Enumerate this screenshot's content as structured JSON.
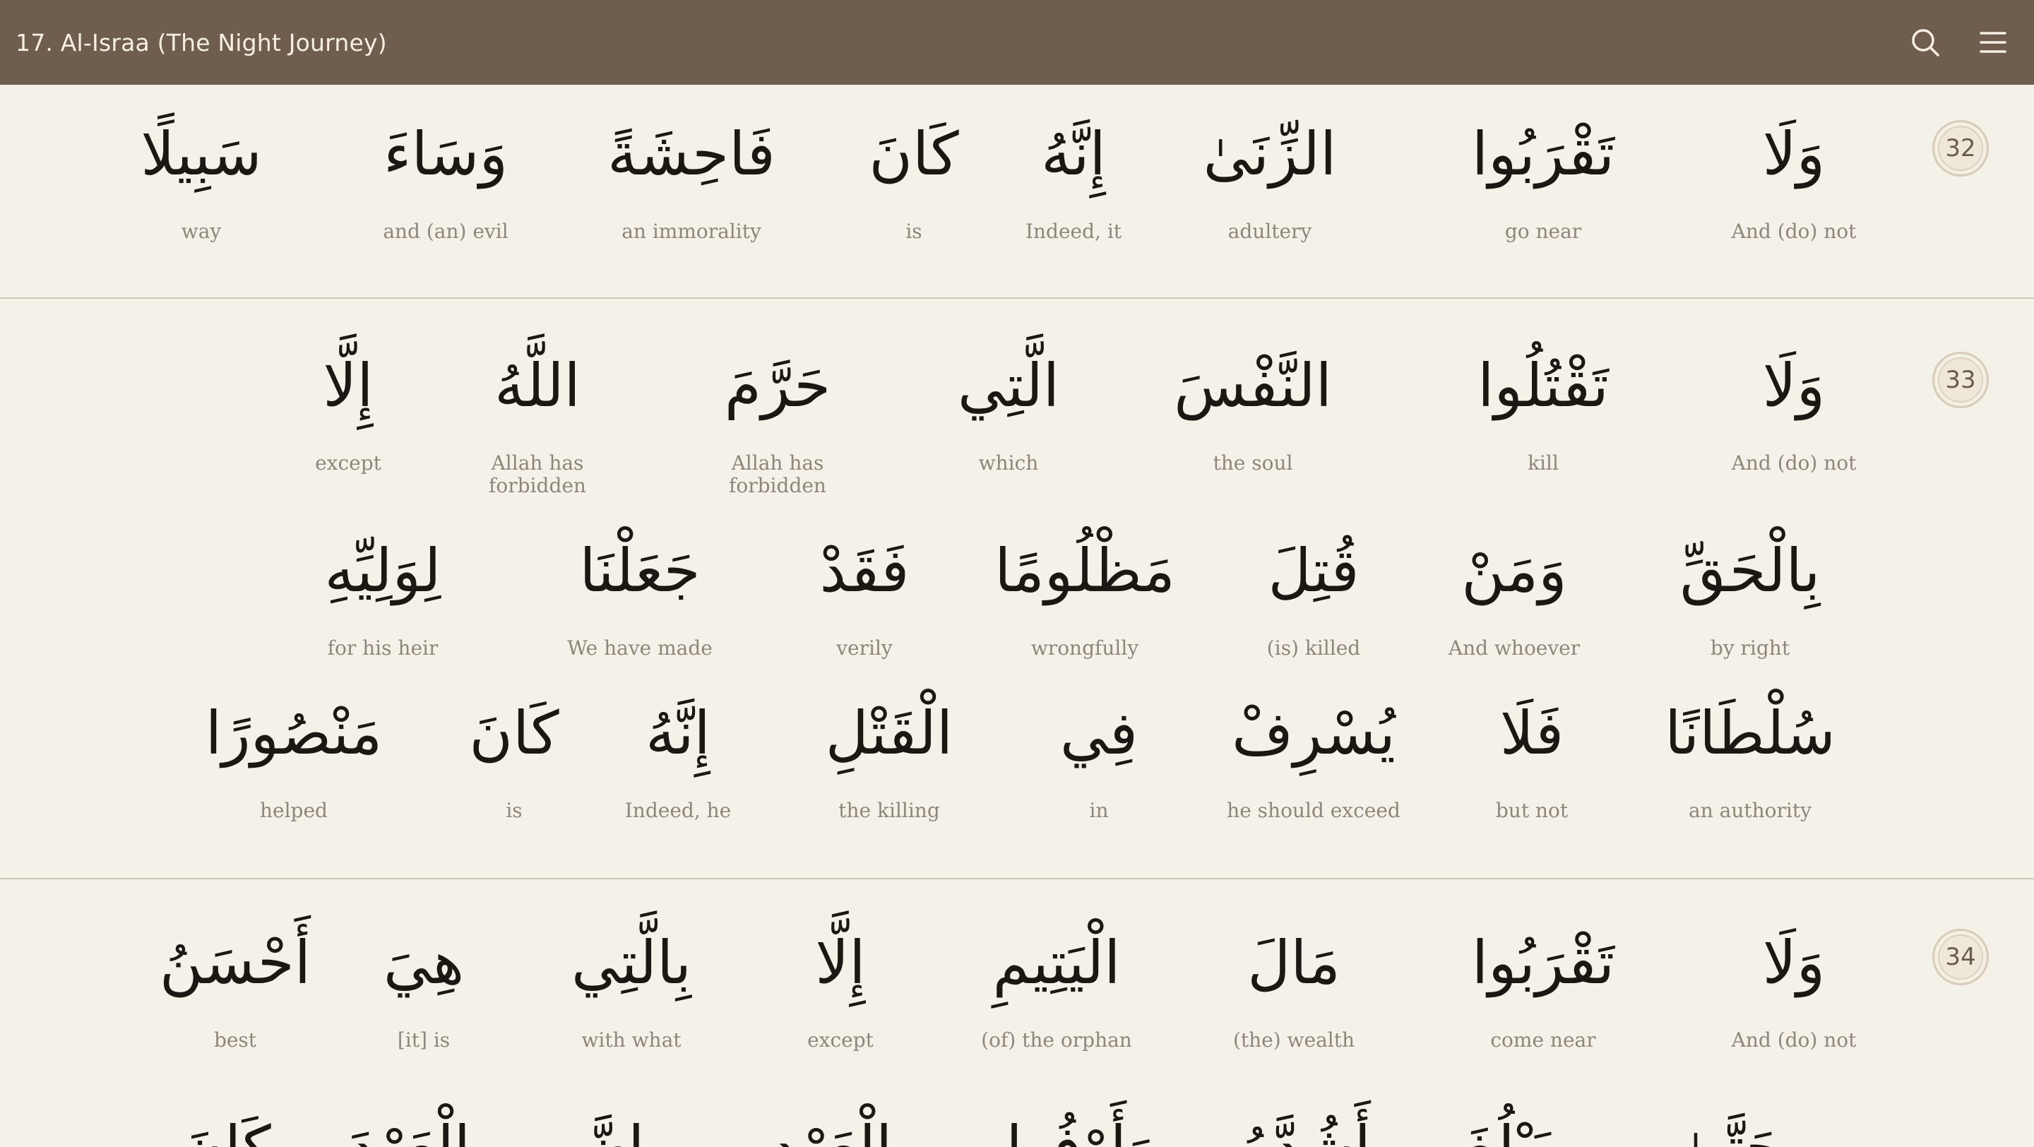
{
  "header": {
    "title": "17. Al-Israa (The Night Journey)",
    "search_icon": "search-icon",
    "menu_icon": "menu-icon"
  },
  "verses": [
    {
      "number": "32",
      "lines": [
        [
          {
            "ar": "وَلَا",
            "en": "And (do) not"
          },
          {
            "ar": "تَقْرَبُوا",
            "en": "go near"
          },
          {
            "ar": "الزِّنَىٰ",
            "en": "adultery"
          },
          {
            "ar": "إِنَّهُ",
            "en": "Indeed, it"
          },
          {
            "ar": "كَانَ",
            "en": "is"
          },
          {
            "ar": "فَاحِشَةً",
            "en": "an immorality"
          },
          {
            "ar": "وَسَاءَ",
            "en": "and (an) evil"
          },
          {
            "ar": "سَبِيلًا",
            "en": "way"
          }
        ]
      ]
    },
    {
      "number": "33",
      "lines": [
        [
          {
            "ar": "وَلَا",
            "en": "And (do) not"
          },
          {
            "ar": "تَقْتُلُوا",
            "en": "kill"
          },
          {
            "ar": "النَّفْسَ",
            "en": "the soul"
          },
          {
            "ar": "الَّتِي",
            "en": "which"
          },
          {
            "ar": "حَرَّمَ",
            "en": "Allah has forbidden"
          },
          {
            "ar": "اللَّهُ",
            "en": "Allah has forbidden"
          },
          {
            "ar": "إِلَّا",
            "en": "except"
          }
        ],
        [
          {
            "ar": "بِالْحَقِّ",
            "en": "by right"
          },
          {
            "ar": "وَمَنْ",
            "en": "And whoever"
          },
          {
            "ar": "قُتِلَ",
            "en": "(is) killed"
          },
          {
            "ar": "مَظْلُومًا",
            "en": "wrongfully"
          },
          {
            "ar": "فَقَدْ",
            "en": "verily"
          },
          {
            "ar": "جَعَلْنَا",
            "en": "We have made"
          },
          {
            "ar": "لِوَلِيِّهِ",
            "en": "for his heir"
          }
        ],
        [
          {
            "ar": "سُلْطَانًا",
            "en": "an authority"
          },
          {
            "ar": "فَلَا",
            "en": "but not"
          },
          {
            "ar": "يُسْرِفْ",
            "en": "he should exceed"
          },
          {
            "ar": "فِي",
            "en": "in"
          },
          {
            "ar": "الْقَتْلِ",
            "en": "the killing"
          },
          {
            "ar": "إِنَّهُ",
            "en": "Indeed, he"
          },
          {
            "ar": "كَانَ",
            "en": "is"
          },
          {
            "ar": "مَنْصُورًا",
            "en": "helped"
          }
        ]
      ]
    },
    {
      "number": "34",
      "lines": [
        [
          {
            "ar": "وَلَا",
            "en": "And (do) not"
          },
          {
            "ar": "تَقْرَبُوا",
            "en": "come near"
          },
          {
            "ar": "مَالَ",
            "en": "(the) wealth"
          },
          {
            "ar": "الْيَتِيمِ",
            "en": "(of) the orphan"
          },
          {
            "ar": "إِلَّا",
            "en": "except"
          },
          {
            "ar": "بِالَّتِي",
            "en": "with what"
          },
          {
            "ar": "هِيَ",
            "en": "[it] is"
          },
          {
            "ar": "أَحْسَنُ",
            "en": "best"
          }
        ],
        [
          {
            "ar": "حَتَّىٰ",
            "en": ""
          },
          {
            "ar": "يَبْلُغَ",
            "en": ""
          },
          {
            "ar": "أَشُدَّهُ",
            "en": ""
          },
          {
            "ar": "وَأَوْفُوا",
            "en": ""
          },
          {
            "ar": "بِالْعَهْدِ",
            "en": ""
          },
          {
            "ar": "إِنَّ",
            "en": ""
          },
          {
            "ar": "الْعَهْدَ",
            "en": ""
          },
          {
            "ar": "كَانَ",
            "en": ""
          }
        ]
      ]
    }
  ]
}
